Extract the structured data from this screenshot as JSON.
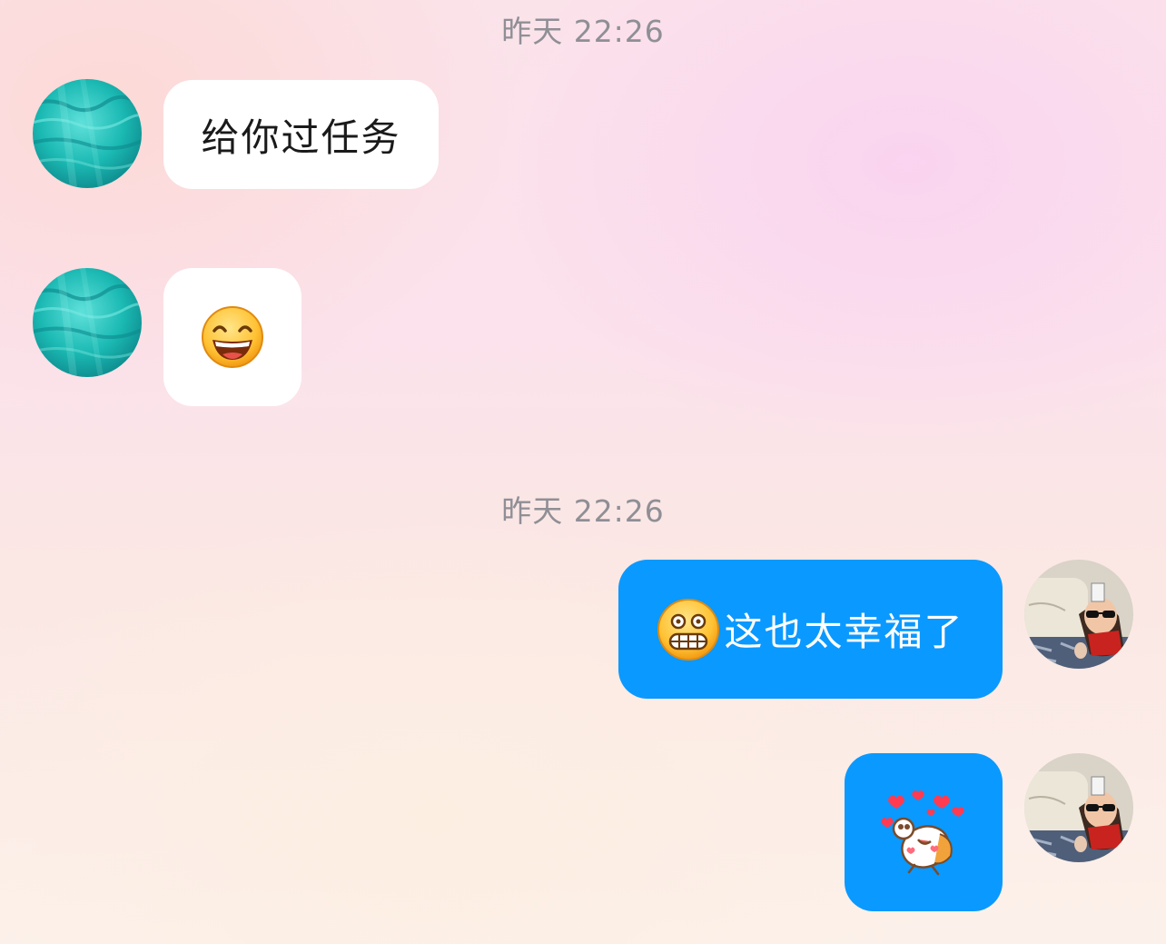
{
  "conversation": {
    "timestamps": [
      "昨天 22:26",
      "昨天 22:26"
    ],
    "messages": [
      {
        "direction": "incoming",
        "type": "text",
        "text": "给你过任务",
        "avatar": "ocean-water-avatar"
      },
      {
        "direction": "incoming",
        "type": "emoji",
        "emoji": "grinning-face-emoji",
        "avatar": "ocean-water-avatar"
      },
      {
        "direction": "outgoing",
        "type": "text",
        "emoji": "grin-emoji",
        "text": "这也太幸福了",
        "avatar": "girl-with-sunglasses-avatar"
      },
      {
        "direction": "outgoing",
        "type": "sticker",
        "sticker": "cartoon-love-sticker",
        "avatar": "girl-with-sunglasses-avatar"
      }
    ]
  },
  "colors": {
    "outgoing_bubble": "#0a99ff",
    "incoming_bubble": "#ffffff",
    "timestamp_text": "#8f8f95"
  }
}
